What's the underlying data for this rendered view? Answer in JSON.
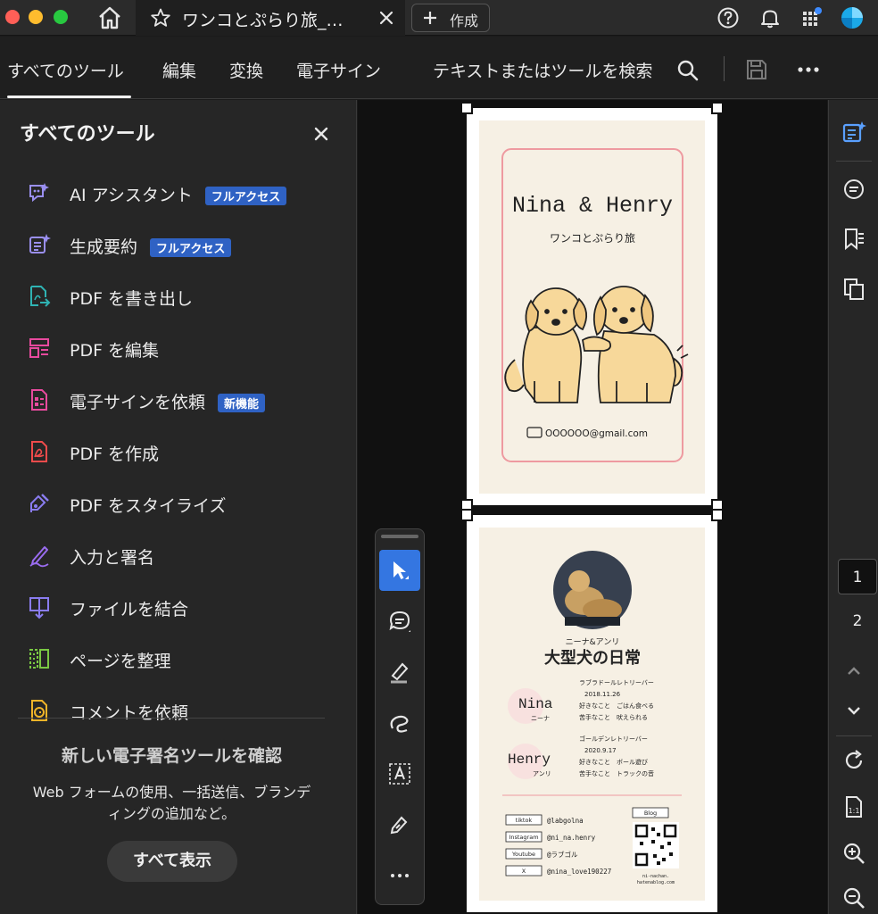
{
  "window": {
    "tab_title": "ワンコとぷらり旅_…",
    "create_label": "作成"
  },
  "nav": {
    "items": [
      "すべてのツール",
      "編集",
      "変換",
      "電子サイン"
    ],
    "search_label": "テキストまたはツールを検索"
  },
  "sidebar": {
    "title": "すべてのツール",
    "tools": [
      {
        "label": "AI アシスタント",
        "badge": "フルアクセス",
        "icon": "ai-assistant-icon"
      },
      {
        "label": "生成要約",
        "badge": "フルアクセス",
        "icon": "summary-icon"
      },
      {
        "label": "PDF を書き出し",
        "badge": "",
        "icon": "export-pdf-icon"
      },
      {
        "label": "PDF を編集",
        "badge": "",
        "icon": "edit-pdf-icon"
      },
      {
        "label": "電子サインを依頼",
        "badge": "新機能",
        "icon": "request-esign-icon"
      },
      {
        "label": "PDF を作成",
        "badge": "",
        "icon": "create-pdf-icon"
      },
      {
        "label": "PDF をスタイライズ",
        "badge": "",
        "icon": "stylize-pdf-icon"
      },
      {
        "label": "入力と署名",
        "badge": "",
        "icon": "fill-sign-icon"
      },
      {
        "label": "ファイルを結合",
        "badge": "",
        "icon": "combine-files-icon"
      },
      {
        "label": "ページを整理",
        "badge": "",
        "icon": "organize-pages-icon"
      },
      {
        "label": "コメントを依頼",
        "badge": "",
        "icon": "request-comments-icon"
      }
    ],
    "promo_title": "新しい電子署名ツールを確認",
    "promo_text": "Web フォームの使用、一括送信、ブランディングの追加など。",
    "show_all": "すべて表示"
  },
  "document": {
    "page1": {
      "title": "Nina & Henry",
      "subtitle": "ワンコとぷらり旅",
      "email": "OOOOOO@gmail.com"
    },
    "page2": {
      "kicker": "ニーナ&アンリ",
      "headline": "大型犬の日常",
      "dogs": [
        {
          "name": "Nina",
          "kana": "ニーナ",
          "breed": "ラブラドールレトリーバー",
          "birthday": "2018.11.26",
          "likes": "好きなこと　ごはん食べる",
          "dislikes": "苦手なこと　吠えられる"
        },
        {
          "name": "Henry",
          "kana": "アンリ",
          "breed": "ゴールデンレトリーバー",
          "birthday": "2020.9.17",
          "likes": "好きなこと　ボール遊び",
          "dislikes": "苦手なこと　トラックの音"
        }
      ],
      "social": [
        {
          "platform": "tiktok",
          "handle": "@labgolna"
        },
        {
          "platform": "Instagram",
          "handle": "@ni_na.henry"
        },
        {
          "platform": "Youtube",
          "handle": "@ラブゴル"
        },
        {
          "platform": "X",
          "handle": "@nina_love190227"
        }
      ],
      "blog_label": "Blog",
      "blog_url_line1": "ni-nachan.",
      "blog_url_line2": "hatenablog.com"
    }
  },
  "pages": {
    "current": "1",
    "other": "2"
  },
  "colors": {
    "accent": "#3476e1",
    "badge": "#2f62c4",
    "card_border": "#ee9aa0",
    "card_bg": "#f6f0e4",
    "dog": "#f7d89a"
  }
}
